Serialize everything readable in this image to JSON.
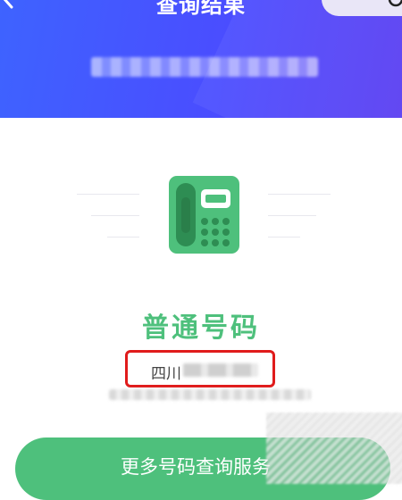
{
  "header": {
    "title": "查询结果",
    "back_icon": "chevron-left-icon",
    "action_icon": "search-icon",
    "background": "#4a4dff"
  },
  "result": {
    "icon": "telephone-icon",
    "type_label": "普通号码",
    "location_prefix": "四川",
    "accent_color": "#4ec07c",
    "highlight_color": "#e01b1b"
  },
  "actions": {
    "more_button_label": "更多号码查询服务"
  }
}
